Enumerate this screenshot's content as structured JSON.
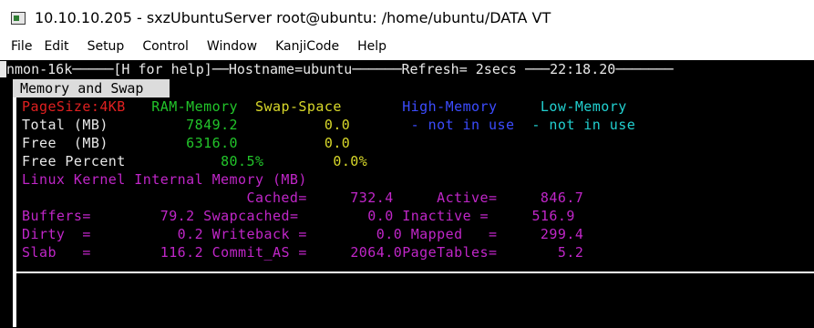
{
  "window": {
    "title": "10.10.10.205 - sxzUbuntuServer root@ubuntu: /home/ubuntu/DATA VT"
  },
  "menu": [
    "File",
    "Edit",
    "Setup",
    "Control",
    "Window",
    "KanjiCode",
    "Help"
  ],
  "terminal": {
    "header": {
      "program": "nmon-16k",
      "help": "[H for help]",
      "hostname": "Hostname=ubuntu",
      "refresh": "Refresh= 2secs",
      "time": "22:18.20"
    },
    "section_title": "Memory and Swap",
    "columns": {
      "pagesize": "PageSize:4KB",
      "ram": "RAM-Memory",
      "swap": "Swap-Space",
      "high": "High-Memory",
      "low": "Low-Memory"
    },
    "rows": {
      "total": {
        "label": "Total (MB)",
        "ram": "7849.2",
        "swap": "0.0",
        "high": "- not in use",
        "low": "- not in use"
      },
      "free": {
        "label": "Free  (MB)",
        "ram": "6316.0",
        "swap": "0.0"
      },
      "free_percent": {
        "label": "Free Percent",
        "ram": "80.5%",
        "swap": "0.0%"
      }
    },
    "kernel_title": "Linux Kernel Internal Memory (MB)",
    "kernel": {
      "cached_label": "Cached=",
      "cached": "732.4",
      "active_label": "Active=",
      "active": "846.7",
      "buffers_label": "Buffers=",
      "buffers": "79.2",
      "swapcached_label": "Swapcached=",
      "swapcached": "0.0",
      "inactive_label": "Inactive =",
      "inactive": "516.9",
      "dirty_label": "Dirty  =",
      "dirty": "0.2",
      "writeback_label": "Writeback =",
      "writeback": "0.0",
      "mapped_label": "Mapped   =",
      "mapped": "299.4",
      "slab_label": "Slab   =",
      "slab": "116.2",
      "commit_label": "Commit_AS =",
      "commit": "2064.0",
      "pagetables_label": "PageTables=",
      "pagetables": "5.2"
    }
  }
}
